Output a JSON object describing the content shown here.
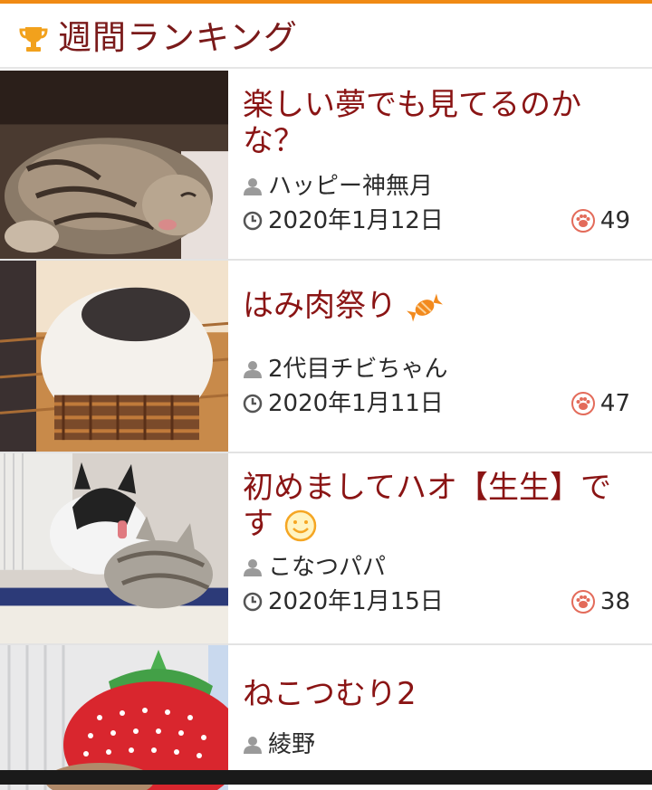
{
  "header": {
    "title": "週間ランキング",
    "icon": "trophy-icon",
    "accent": "#f08a14",
    "title_color": "#7a1a1a"
  },
  "items": [
    {
      "title": "楽しい夢でも見てるのかな？",
      "author": "ハッピー神無月",
      "date": "2020年1月12日",
      "likes": "49",
      "thumbnail": "sleeping tabby cat"
    },
    {
      "title": "はみ肉祭り",
      "title_emoji": "candy-icon",
      "author": "2代目チビちゃん",
      "date": "2020年1月11日",
      "likes": "47",
      "thumbnail": "white cat in basket"
    },
    {
      "title": "初めましてハオ【生生】です",
      "title_emoji": "smiley-icon",
      "author": "こなつパパ",
      "date": "2020年1月15日",
      "likes": "38",
      "thumbnail": "two cats grooming"
    },
    {
      "title": "ねこつむり2",
      "author": "綾野",
      "thumbnail": "strawberry hat cat"
    }
  ]
}
